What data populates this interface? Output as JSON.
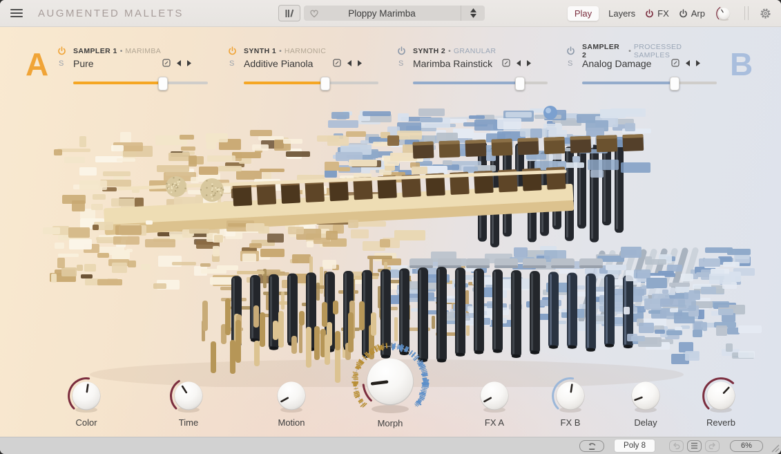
{
  "titlebar": {
    "title": "AUGMENTED MALLETS",
    "preset_name": "Ploppy Marimba",
    "nav": {
      "play": "Play",
      "layers": "Layers",
      "fx": "FX",
      "arp": "Arp"
    },
    "master_volume": {
      "value": 0.38,
      "accent": "#7b2d3e"
    }
  },
  "layers": {
    "side_a_label": "A",
    "side_b_label": "B",
    "solo_label": "S",
    "bullet": "•",
    "slots": [
      {
        "engine": "SAMPLER 1",
        "category": "MARIMBA",
        "preset": "Pure",
        "side": "a",
        "level": 0.66
      },
      {
        "engine": "SYNTH 1",
        "category": "HARMONIC",
        "preset": "Additive Pianola",
        "side": "a",
        "level": 0.6
      },
      {
        "engine": "SYNTH 2",
        "category": "GRANULAR",
        "preset": "Marimba Rainstick",
        "side": "b",
        "level": 0.79
      },
      {
        "engine": "SAMPLER 2",
        "category": "PROCESSED SAMPLES",
        "preset": "Analog Damage",
        "side": "b",
        "level": 0.68
      }
    ]
  },
  "macros": [
    {
      "label": "Color",
      "value": 0.53,
      "accent": "#7b2d3e",
      "size": "small"
    },
    {
      "label": "Time",
      "value": 0.38,
      "accent": "#7b2d3e",
      "size": "small"
    },
    {
      "label": "Motion",
      "value": 0.06,
      "accent": null,
      "size": "small"
    },
    {
      "label": "Morph",
      "value": 0.14,
      "accent": "#7b2d3e",
      "size": "large"
    },
    {
      "label": "FX A",
      "value": 0.06,
      "accent": null,
      "size": "small"
    },
    {
      "label": "FX B",
      "value": 0.53,
      "accent": "#9bb7d9",
      "size": "small"
    },
    {
      "label": "Delay",
      "value": 0.09,
      "accent": null,
      "size": "small"
    },
    {
      "label": "Reverb",
      "value": 0.66,
      "accent": "#7b2d3e",
      "size": "small"
    }
  ],
  "footer": {
    "poly_label": "Poly 8",
    "cpu_label": "6%"
  },
  "colors": {
    "accent_maroon": "#7b2d3e",
    "side_a_orange": "#f5a623",
    "side_a_letter": "#f0a437",
    "side_b_blue": "#93abcb",
    "side_b_letter": "#a9bedd",
    "power_a": "#f0a437",
    "power_b": "#8d99a9",
    "morph_gold": "#b98f35",
    "morph_blue": "#5d8fc9"
  }
}
